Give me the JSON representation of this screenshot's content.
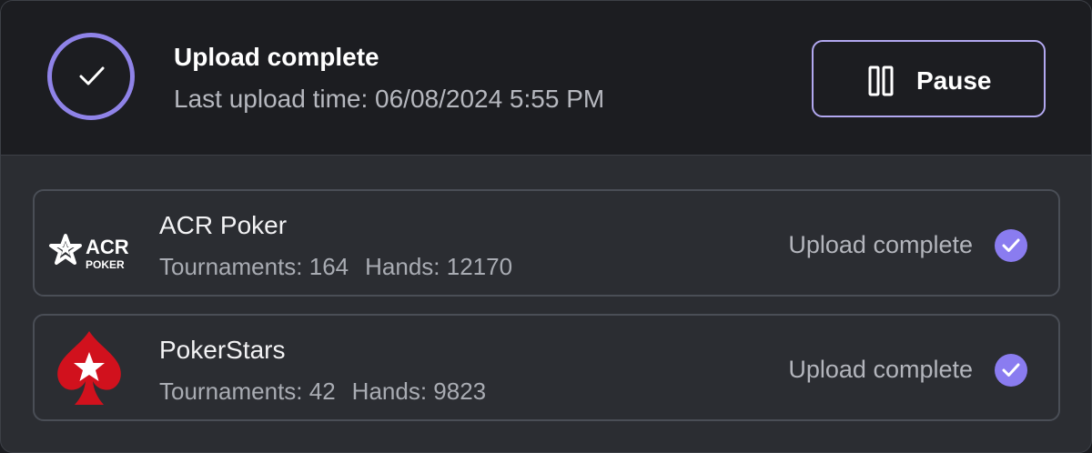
{
  "header": {
    "title": "Upload complete",
    "subtitle": "Last upload time: 06/08/2024 5:55 PM",
    "pause_label": "Pause",
    "accent_color": "#8f83e8"
  },
  "sites": [
    {
      "name": "ACR Poker",
      "logo_text_main": "ACR",
      "logo_text_sub": "POKER",
      "tournaments": "Tournaments: 164",
      "hands": "Hands: 12170",
      "status": "Upload complete",
      "logo_icon": "acr-poker-logo"
    },
    {
      "name": "PokerStars",
      "tournaments": "Tournaments: 42",
      "hands": "Hands: 9823",
      "status": "Upload complete",
      "logo_icon": "pokerstars-logo",
      "logo_color": "#d1111d"
    }
  ]
}
